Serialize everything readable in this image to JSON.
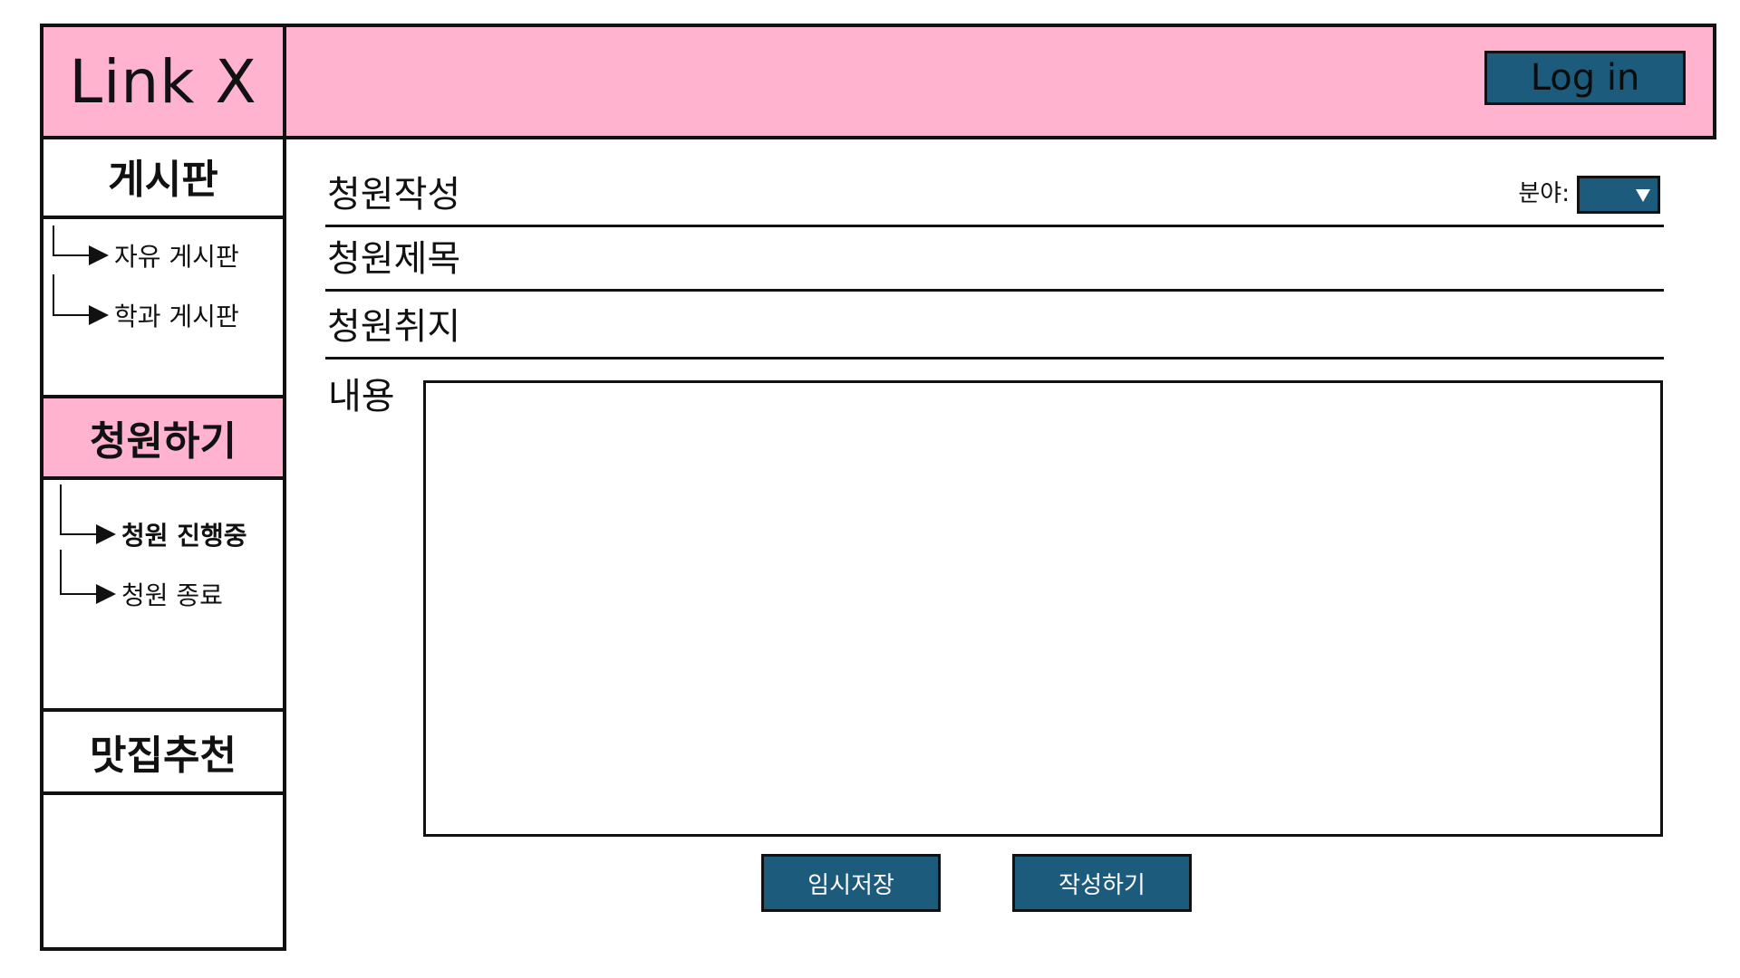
{
  "app": {
    "logo_text": "Link X"
  },
  "header": {
    "login_label": "Log in"
  },
  "sidebar": {
    "board": {
      "title": "게시판",
      "items": [
        {
          "label": "자유 게시판"
        },
        {
          "label": "학과 게시판"
        }
      ]
    },
    "petition": {
      "title": "청원하기",
      "items": [
        {
          "label": "청원 진행중",
          "active": true
        },
        {
          "label": "청원 종료"
        }
      ]
    },
    "food": {
      "title": "맛집추천"
    }
  },
  "form": {
    "heading": "청원작성",
    "category_label": "분야:",
    "category_value": "",
    "title_label": "청원제목",
    "title_value": "",
    "purpose_label": "청원취지",
    "purpose_value": "",
    "content_label": "내용",
    "content_value": ""
  },
  "actions": {
    "save_draft_label": "임시저장",
    "submit_label": "작성하기"
  },
  "colors": {
    "accent_pink": "#ffb3cf",
    "button_blue": "#1d5b7d",
    "border": "#111111"
  },
  "icons": {
    "submenu_arrow": "right-arrow-icon",
    "dropdown_caret": "chevron-down-icon"
  }
}
